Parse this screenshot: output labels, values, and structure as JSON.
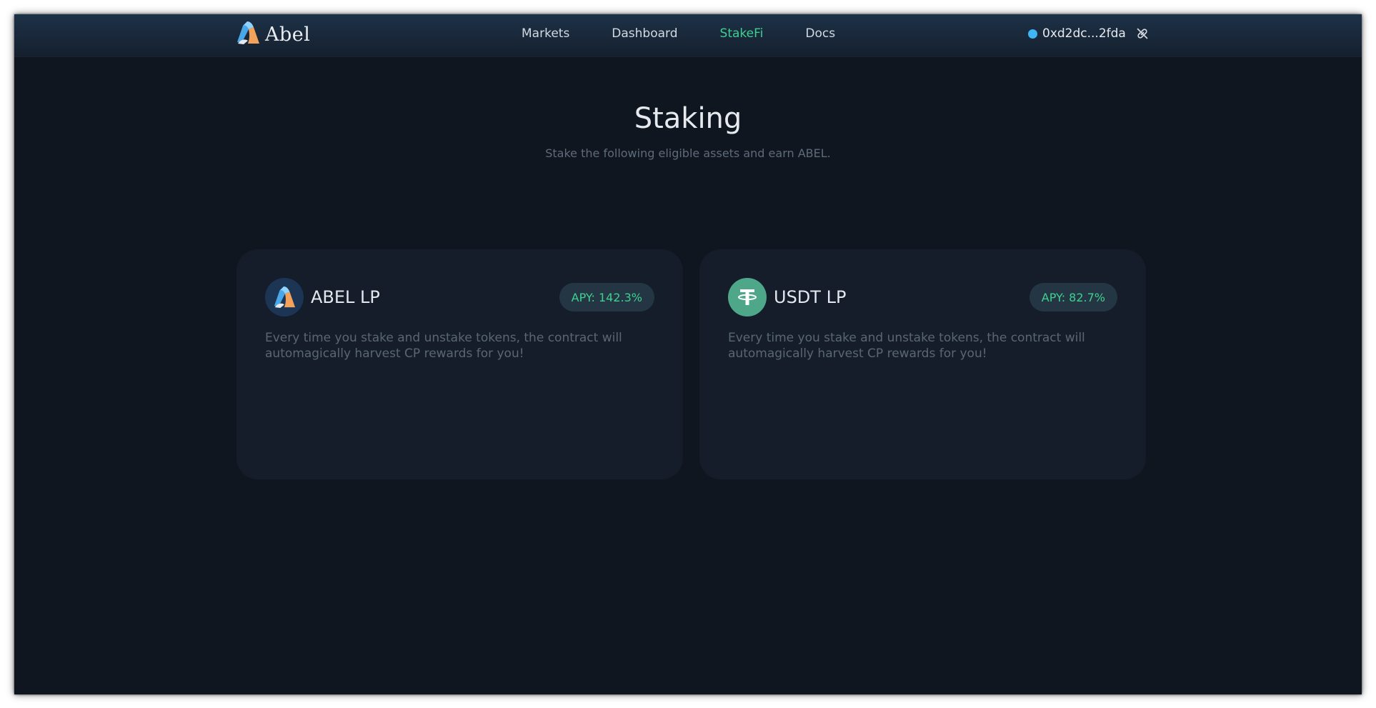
{
  "header": {
    "logo_text": "Abel",
    "nav": [
      {
        "label": "Markets",
        "active": false
      },
      {
        "label": "Dashboard",
        "active": false
      },
      {
        "label": "StakeFi",
        "active": true
      },
      {
        "label": "Docs",
        "active": false
      }
    ],
    "wallet": {
      "address": "0xd2dc...2fda",
      "status_color": "#3fb5f5"
    }
  },
  "page": {
    "title": "Staking",
    "subtitle": "Stake the following eligible assets and earn ABEL."
  },
  "pools": [
    {
      "name": "ABEL LP",
      "icon": "abel-logo-icon",
      "apy": "APY: 142.3%",
      "description": "Every time you stake and unstake tokens, the contract will automagically harvest CP rewards for you!"
    },
    {
      "name": "USDT LP",
      "icon": "tether-icon",
      "apy": "APY: 82.7%",
      "description": "Every time you stake and unstake tokens, the contract will automagically harvest CP rewards for you!"
    }
  ],
  "colors": {
    "background": "#10161f",
    "card": "#141d29",
    "accent_green": "#3fd08f",
    "tether_green": "#4fa78a"
  }
}
